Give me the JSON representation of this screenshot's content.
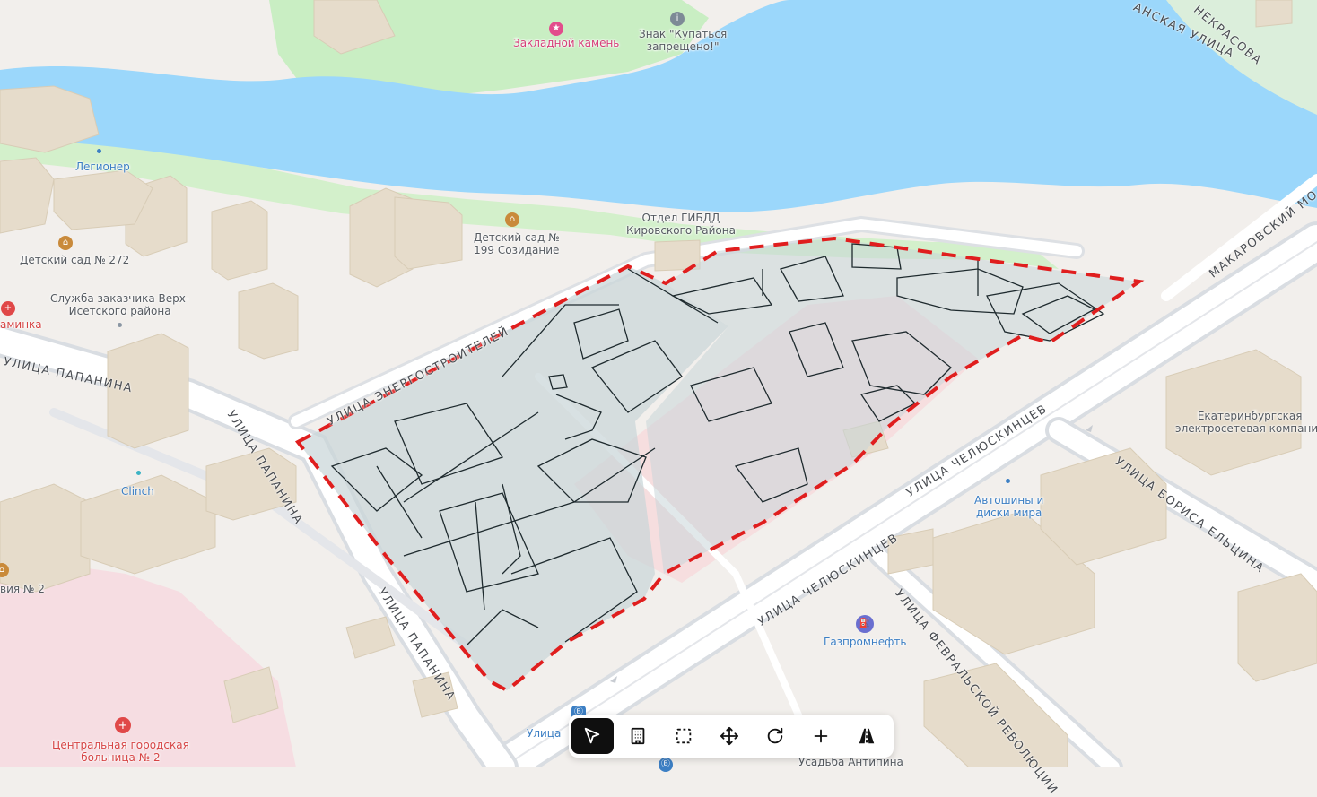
{
  "map": {
    "colors": {
      "water": "#9bd7fb",
      "park": "#c7eec1",
      "building": "#e3d8c6",
      "road": "#ffffff",
      "site_fill": "#c9d6d8",
      "site_border": "#e01e1e",
      "hospital_zone": "#f5dbe0"
    },
    "pois": [
      {
        "id": "zakladnoy",
        "label": "Закладной камень",
        "style": "pink",
        "icon": "monument-icon"
      },
      {
        "id": "znak",
        "label": "Знак \"Купаться\nзапрещено!\"",
        "style": "gray",
        "icon": "info-icon"
      },
      {
        "id": "legioner",
        "label": "Легионер",
        "style": "blue",
        "icon": "dot"
      },
      {
        "id": "sad272",
        "label": "Детский сад № 272",
        "style": "gray",
        "icon": "kindergarten-icon"
      },
      {
        "id": "sad199",
        "label": "Детский сад №\n199 Созидание",
        "style": "gray",
        "icon": "kindergarten-icon"
      },
      {
        "id": "gibdd",
        "label": "Отдел ГИБДД\nКировского Района",
        "style": "gray",
        "icon": "none"
      },
      {
        "id": "sluzhba",
        "label": "Служба заказчика Верх-\nИсетского района",
        "style": "gray",
        "icon": "dot"
      },
      {
        "id": "aminka",
        "label": "аминка",
        "style": "red",
        "icon": "pharmacy-icon"
      },
      {
        "id": "clinch",
        "label": "Clinch",
        "style": "blue",
        "icon": "dot"
      },
      {
        "id": "viya2",
        "label": "вия № 2",
        "style": "gray",
        "icon": "school-icon"
      },
      {
        "id": "ekb",
        "label": "Екатеринбургская\nэлектросетевая компания",
        "style": "gray",
        "icon": "none"
      },
      {
        "id": "avto",
        "label": "Автошины и\nдиски мира",
        "style": "blue",
        "icon": "dot"
      },
      {
        "id": "gazprom",
        "label": "Газпромнефть",
        "style": "blue",
        "icon": "fuel-icon"
      },
      {
        "id": "hospital",
        "label": "Центральная городская\nбольница № 2",
        "style": "red",
        "icon": "hospital-icon"
      },
      {
        "id": "usadba",
        "label": "Усадьба Антипина",
        "style": "gray",
        "icon": "none"
      },
      {
        "id": "ulitsa",
        "label": "Улица",
        "style": "blue",
        "icon": "metro-icon"
      }
    ],
    "streets": [
      {
        "id": "papanina1",
        "label": "УЛИЦА ПАПАНИНА"
      },
      {
        "id": "papanina2",
        "label": "УЛИЦА ПАПАНИНА"
      },
      {
        "id": "papanina3",
        "label": "УЛИЦА ПАПАНИНА"
      },
      {
        "id": "energo",
        "label": "УЛИЦА ЭНЕРГОСТРОИТЕЛЕЙ"
      },
      {
        "id": "chel1",
        "label": "УЛИЦА ЧЕЛЮСКИНЦЕВ"
      },
      {
        "id": "chel2",
        "label": "УЛИЦА ЧЕЛЮСКИНЦЕВ"
      },
      {
        "id": "makar",
        "label": "МАКАРОВСКИЙ МО"
      },
      {
        "id": "eltsin",
        "label": "УЛИЦА БОРИСА ЕЛЬЦИНА"
      },
      {
        "id": "fevral",
        "label": "УЛИЦА ФЕВРАЛЬСКОЙ РЕВОЛЮЦИИ"
      },
      {
        "id": "nekrasova",
        "label": "НЕКРАСОВА"
      },
      {
        "id": "anskaya",
        "label": "АНСКАЯ УЛИЦА"
      }
    ]
  },
  "toolbar": {
    "tools": [
      {
        "id": "select",
        "name": "select-tool-button",
        "icon": "cursor-arrow-icon",
        "active": true
      },
      {
        "id": "building",
        "name": "building-tool-button",
        "icon": "building-icon",
        "active": false
      },
      {
        "id": "marquee",
        "name": "area-select-tool-button",
        "icon": "dashed-rectangle-icon",
        "active": false
      },
      {
        "id": "move",
        "name": "move-tool-button",
        "icon": "move-arrows-icon",
        "active": false
      },
      {
        "id": "rotate",
        "name": "rotate-tool-button",
        "icon": "rotate-icon",
        "active": false
      },
      {
        "id": "add",
        "name": "add-tool-button",
        "icon": "plus-icon",
        "active": false
      },
      {
        "id": "road",
        "name": "road-tool-button",
        "icon": "road-icon",
        "active": false
      }
    ]
  }
}
